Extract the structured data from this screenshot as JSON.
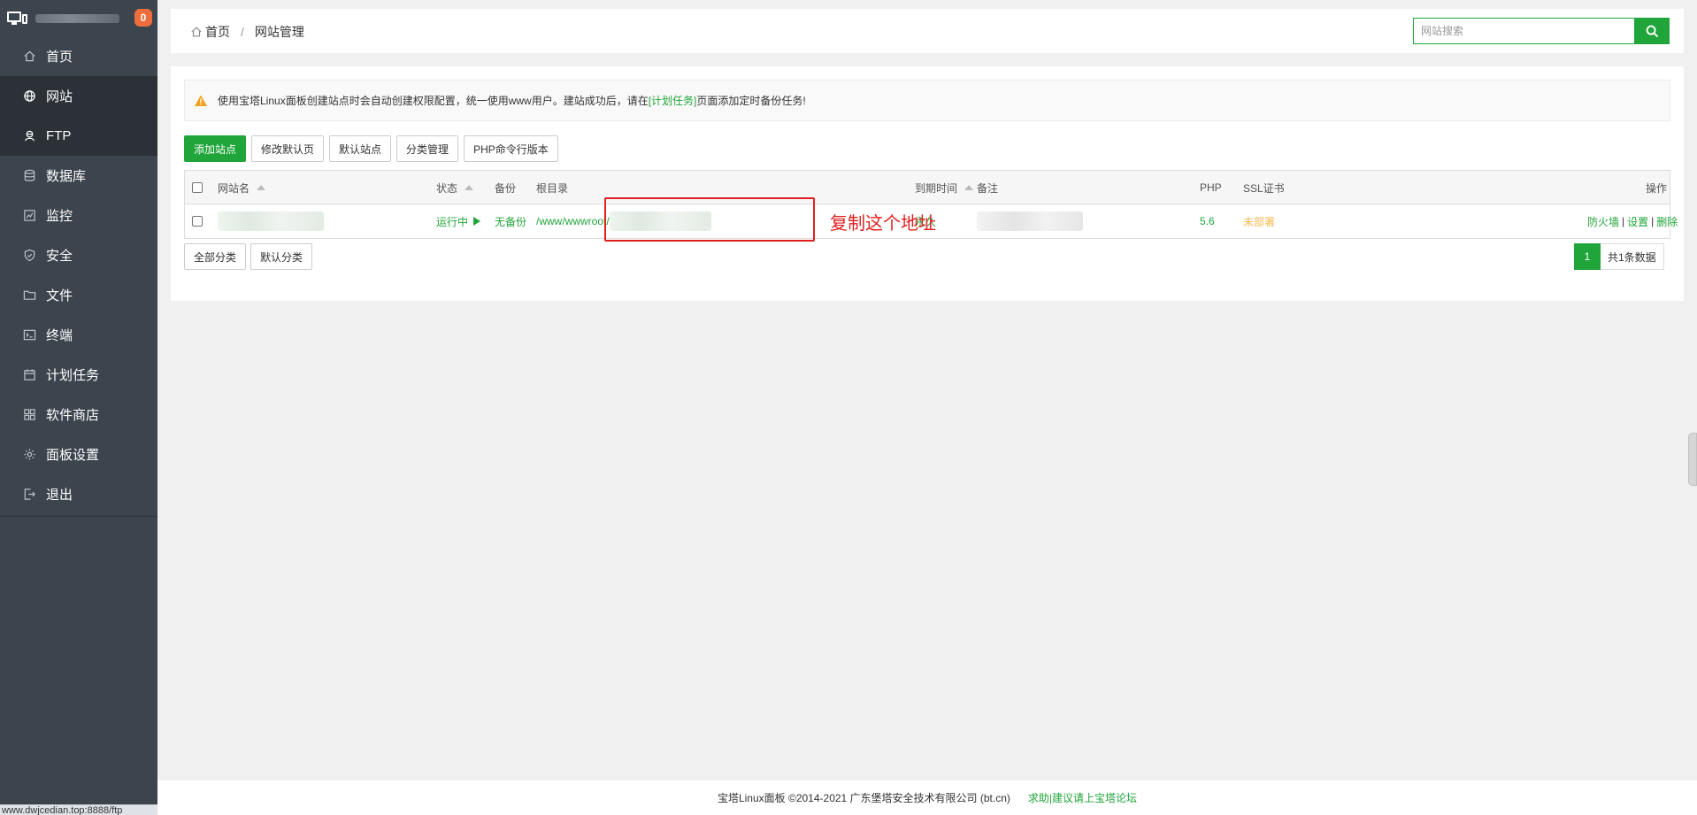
{
  "sidebar": {
    "badge": "0",
    "items": [
      {
        "label": "首页",
        "icon": "home-icon"
      },
      {
        "label": "网站",
        "icon": "globe-icon"
      },
      {
        "label": "FTP",
        "icon": "ftp-icon"
      },
      {
        "label": "数据库",
        "icon": "database-icon"
      },
      {
        "label": "监控",
        "icon": "monitor-chart-icon"
      },
      {
        "label": "安全",
        "icon": "shield-icon"
      },
      {
        "label": "文件",
        "icon": "folder-icon"
      },
      {
        "label": "终端",
        "icon": "terminal-icon"
      },
      {
        "label": "计划任务",
        "icon": "calendar-icon"
      },
      {
        "label": "软件商店",
        "icon": "apps-grid-icon"
      },
      {
        "label": "面板设置",
        "icon": "gear-icon"
      },
      {
        "label": "退出",
        "icon": "logout-icon"
      }
    ],
    "active_index": 1
  },
  "status_bar_url": "www.dwjcedian.top:8888/ftp",
  "header": {
    "breadcrumb": [
      "首页",
      "网站管理"
    ],
    "search_placeholder": "网站搜索"
  },
  "notice": {
    "text_before": "使用宝塔Linux面板创建站点时会自动创建权限配置，统一使用www用户。建站成功后，请在",
    "link": "[计划任务]",
    "text_after": "页面添加定时备份任务!"
  },
  "toolbar": {
    "add_site": "添加站点",
    "edit_default_page": "修改默认页",
    "default_site": "默认站点",
    "category_manage": "分类管理",
    "php_cli_version": "PHP命令行版本"
  },
  "table": {
    "headers": {
      "name": "网站名",
      "status": "状态",
      "backup": "备份",
      "root": "根目录",
      "expire": "到期时间",
      "note": "备注",
      "php": "PHP",
      "ssl": "SSL证书",
      "ops": "操作"
    },
    "rows": [
      {
        "status": "运行中",
        "backup": "无备份",
        "root": "/www/wwwroot/",
        "expire": "永久",
        "php": "5.6",
        "ssl": "未部署",
        "ops": [
          "防火墙",
          "设置",
          "删除"
        ]
      }
    ]
  },
  "annotation": "复制这个地址",
  "footer_buttons": {
    "all_categories": "全部分类",
    "default_category": "默认分类"
  },
  "pagination": {
    "current_page": "1",
    "total": "共1条数据"
  },
  "footer": {
    "copyright": "宝塔Linux面板 ©2014-2021 广东堡塔安全技术有限公司 (bt.cn)",
    "link": "求助|建议请上宝塔论坛"
  },
  "colors": {
    "brand_green": "#20a53a",
    "sidebar_bg": "#3c444d",
    "annotation_red": "#e02020",
    "ssl_orange": "#f7b851"
  }
}
